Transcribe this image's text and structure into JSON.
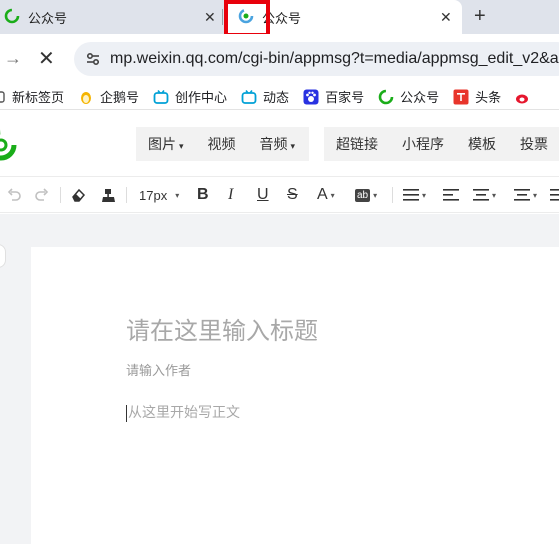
{
  "browser": {
    "tabs": [
      {
        "title": "公众号",
        "close": "✕"
      },
      {
        "title": "公众号",
        "close": "✕"
      }
    ],
    "new_tab": "+",
    "nav": {
      "forward": "→",
      "stop": "✕"
    },
    "url": "mp.weixin.qq.com/cgi-bin/appmsg?t=media/appmsg_edit_v2&a...",
    "bookmarks": [
      {
        "label": "新标签页",
        "icon": "new-tab-icon"
      },
      {
        "label": "企鹅号",
        "icon": "penguin-icon"
      },
      {
        "label": "创作中心",
        "icon": "bilibili-icon"
      },
      {
        "label": "动态",
        "icon": "bilibili-icon"
      },
      {
        "label": "百家号",
        "icon": "baidu-paw-icon"
      },
      {
        "label": "公众号",
        "icon": "wechat-official-icon"
      },
      {
        "label": "头条",
        "icon": "toutiao-icon"
      }
    ],
    "accent_color": "#e8000b"
  },
  "editor": {
    "menu_group_1": [
      {
        "label": "图片",
        "caret": "▾"
      },
      {
        "label": "视频",
        "caret": ""
      },
      {
        "label": "音频",
        "caret": "▾"
      }
    ],
    "menu_group_2": [
      {
        "label": "超链接"
      },
      {
        "label": "小程序"
      },
      {
        "label": "模板"
      },
      {
        "label": "投票"
      }
    ],
    "toolbar": {
      "font_size": "17px",
      "bold": "B",
      "italic": "I",
      "underline": "U",
      "strike": "S",
      "font_color": "A",
      "bg_color": "ab"
    },
    "title_placeholder": "请在这里输入标题",
    "author_placeholder": "请输入作者",
    "body_placeholder": "从这里开始写正文"
  }
}
